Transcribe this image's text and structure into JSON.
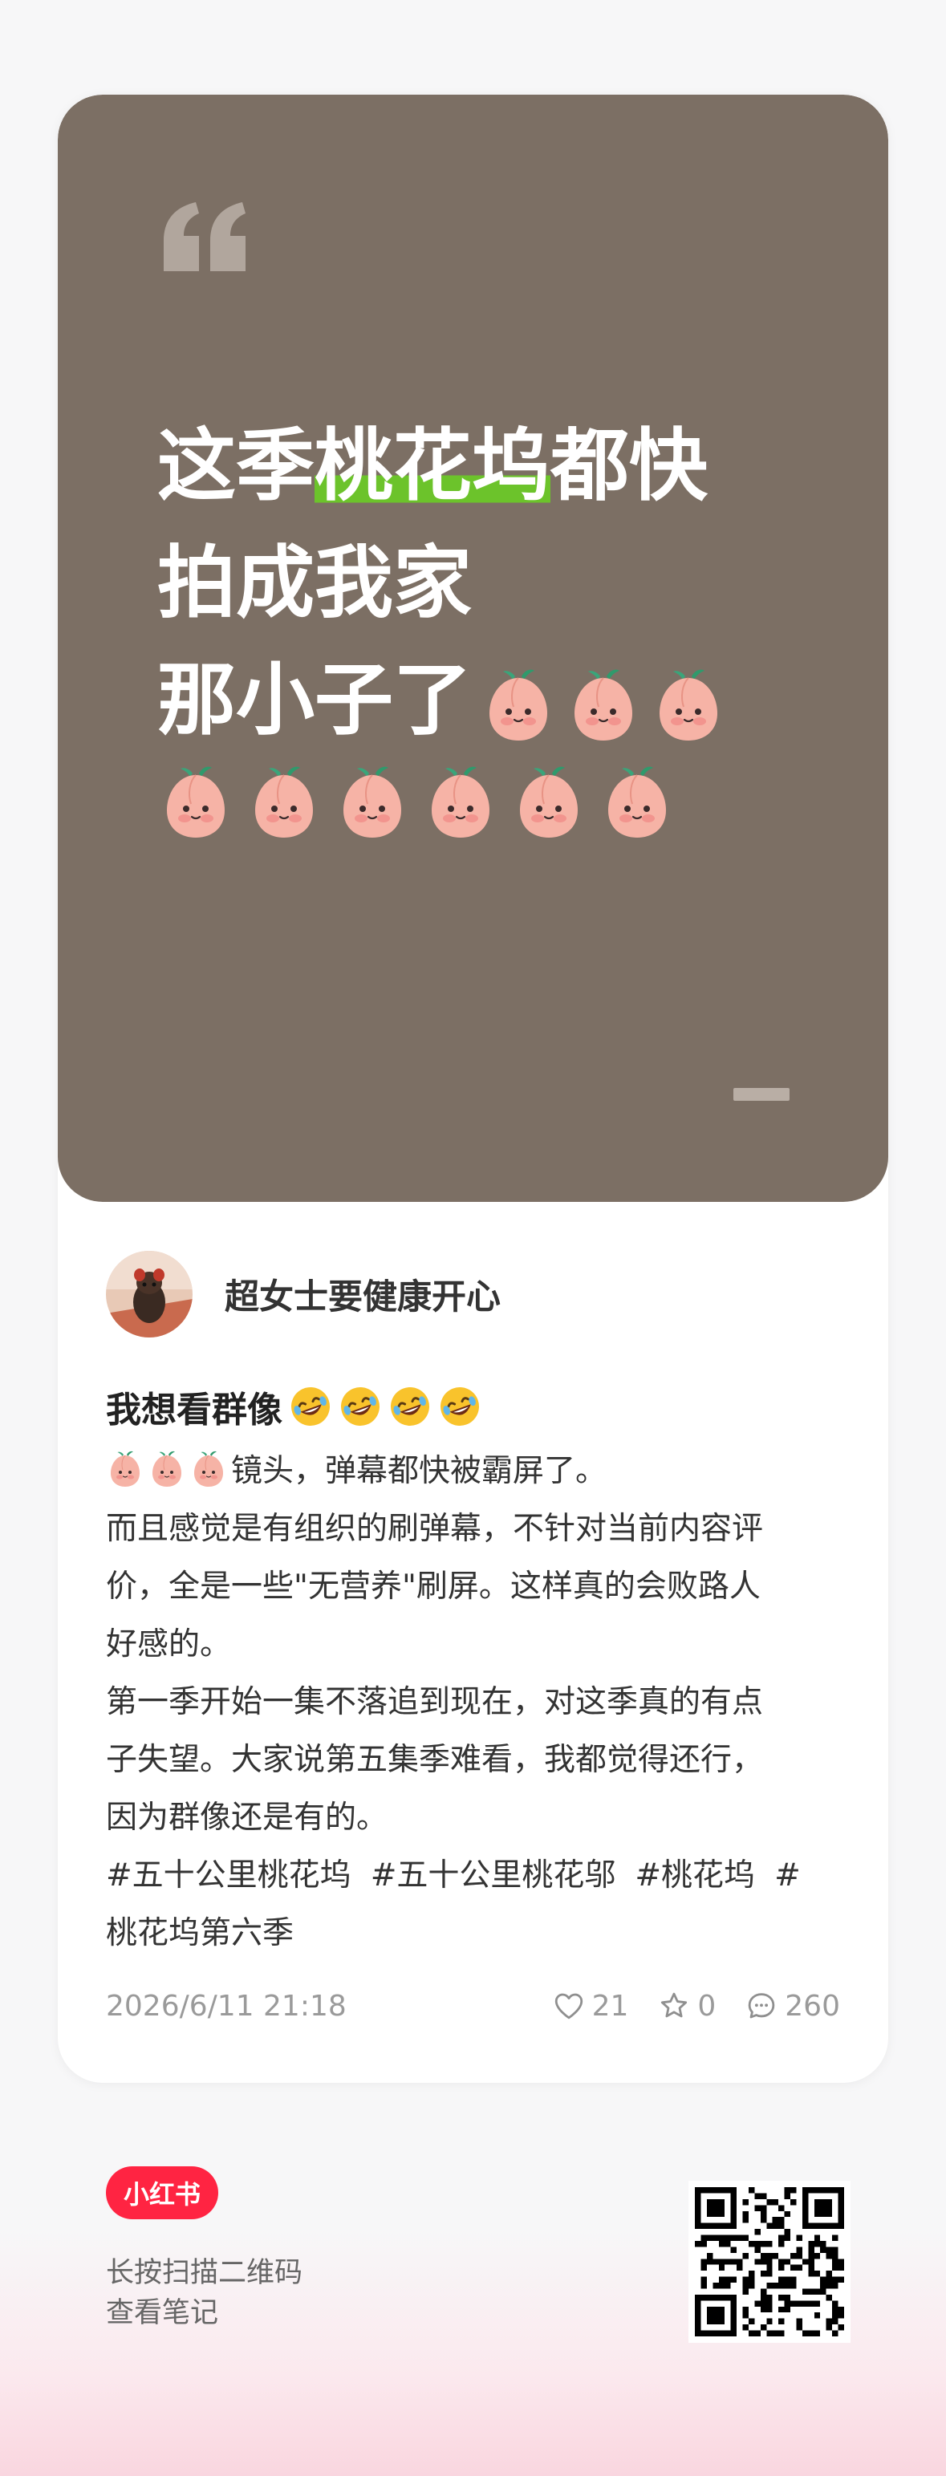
{
  "cover": {
    "line1_pre": "这季",
    "line1_highlight": "桃花坞",
    "line1_post": "都快",
    "line2": "拍成我家",
    "line3": "那小子了",
    "highlight_color": "#6cc32b",
    "background_color": "#7c6f64",
    "inline_peach_icons": [
      "peach-icon",
      "peach-icon",
      "peach-icon"
    ],
    "row_peach_icons": [
      "peach-icon",
      "peach-icon",
      "peach-icon",
      "peach-icon",
      "peach-icon",
      "peach-icon"
    ]
  },
  "author": {
    "name": "超女士要健康开心",
    "avatar_icon": "avatar-dog-photo"
  },
  "post": {
    "title": "我想看群像",
    "title_emojis": [
      "rolling-laugh-icon",
      "rolling-laugh-icon",
      "rolling-laugh-icon",
      "rolling-laugh-icon"
    ],
    "lines": [
      "镜头，弹幕都快被霸屏了。",
      "而且感觉是有组织的刷弹幕，不针对当前内容评",
      "价，全是一些\"无营养\"刷屏。这样真的会败路人",
      "好感的。",
      "第一季开始一集不落追到现在，对这季真的有点",
      "子失望。大家说第五集季难看，我都觉得还行，",
      "因为群像还是有的。"
    ],
    "tags_line1": [
      "#五十公里桃花坞",
      "#五十公里桃花邬",
      "#桃花坞",
      "#"
    ],
    "tags_line2": "桃花坞第六季"
  },
  "meta": {
    "timestamp": "2026/6/11 21:18",
    "likes": "21",
    "stars": "0",
    "comments": "260"
  },
  "footer": {
    "logo_text": "小红书",
    "logo_color": "#ff2442",
    "line1": "长按扫描二维码",
    "line2": "查看笔记"
  }
}
